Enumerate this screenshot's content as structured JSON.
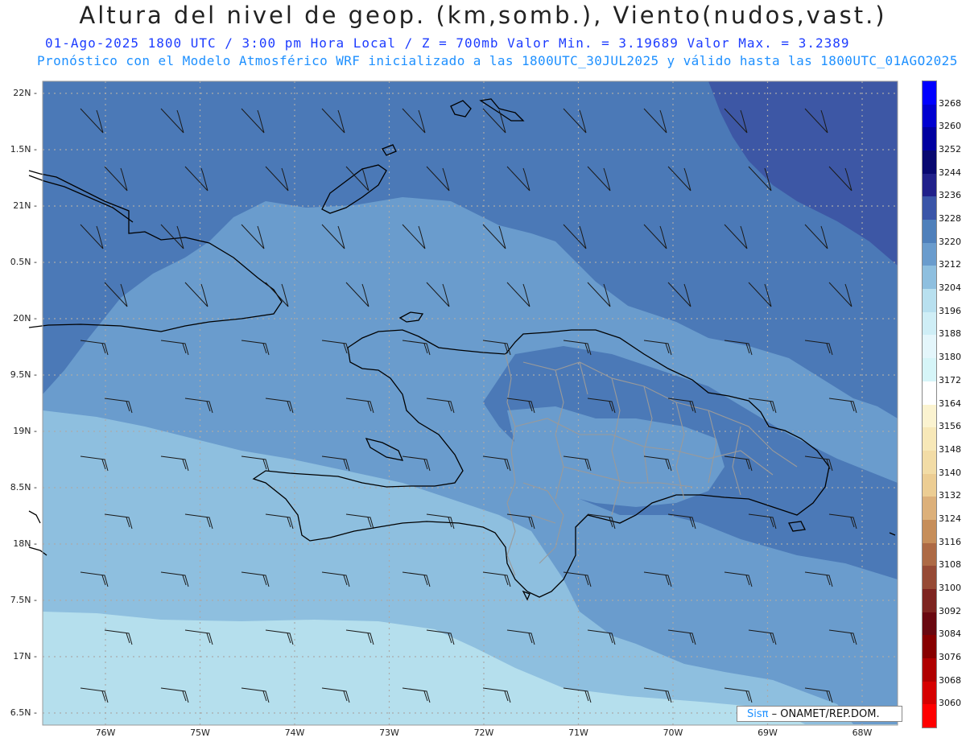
{
  "header": {
    "title": "Altura del nivel de geop. (km,somb.), Viento(nudos,vast.)",
    "line1": "01-Ago-2025  1800 UTC / 3:00 pm Hora Local / Z = 700mb     Valor Min. = 3.19689  Valor Max. = 3.2389",
    "line2": "Pronóstico con el Modelo Atmosférico WRF inicializado a las 1800UTC_30JUL2025 y válido hasta las  1800UTC_01AGO2025"
  },
  "axes": {
    "y_labels": [
      "22N",
      "1.5N",
      "21N",
      "0.5N",
      "20N",
      "9.5N",
      "19N",
      "8.5N",
      "18N",
      "7.5N",
      "17N",
      "6.5N"
    ],
    "x_labels": [
      "76W",
      "75W",
      "74W",
      "73W",
      "72W",
      "71W",
      "70W",
      "69W",
      "68W"
    ]
  },
  "colorbar": {
    "labels": [
      "3268",
      "3260",
      "3252",
      "3244",
      "3236",
      "3228",
      "3220",
      "3212",
      "3204",
      "3196",
      "3188",
      "3180",
      "3172",
      "3164",
      "3156",
      "3148",
      "3140",
      "3132",
      "3124",
      "3116",
      "3108",
      "3100",
      "3092",
      "3084",
      "3076",
      "3068",
      "3060"
    ],
    "colors": [
      "#0000ff",
      "#0000d0",
      "#0000a0",
      "#080870",
      "#20208a",
      "#3a55a8",
      "#4f80bb",
      "#6a9ccd",
      "#8ebfdf",
      "#b8e0ef",
      "#cfeef6",
      "#e4f6fb",
      "#d6f5f8",
      "#ffffff",
      "#fbf3d0",
      "#f7e8b8",
      "#f2dca6",
      "#eccd93",
      "#dcb07a",
      "#c68e5a",
      "#ad6a45",
      "#964a35",
      "#7d2420",
      "#690810",
      "#870000",
      "#b00000",
      "#d60000",
      "#ff0000"
    ]
  },
  "brand": {
    "prefix": "Sis",
    "pi": "π",
    "suffix": "– ONAMET/REP.DOM."
  },
  "fill_colors": {
    "deep": "#3d57a5",
    "dark": "#4b79b7",
    "mid": "#6a9ccd",
    "light": "#8ebfdf",
    "pale": "#b5dfed"
  }
}
